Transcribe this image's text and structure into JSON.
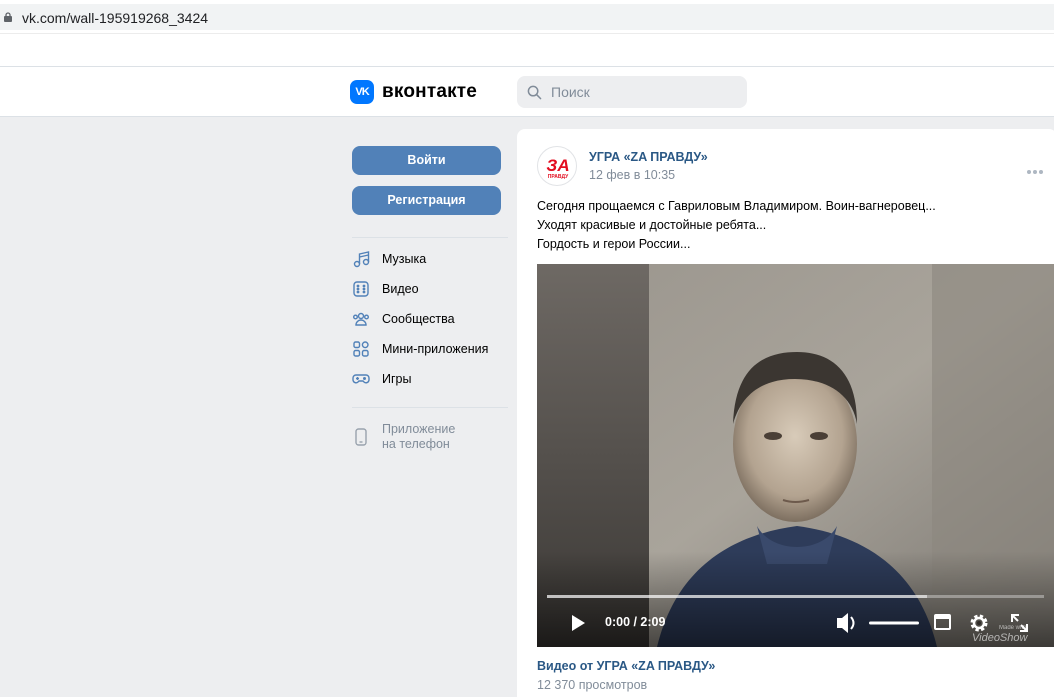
{
  "browser": {
    "url": "vk.com/wall-195919268_3424"
  },
  "header": {
    "logo_text": "вконтакте",
    "logo_mark": "VK",
    "search_placeholder": "Поиск"
  },
  "sidebar": {
    "login_label": "Войти",
    "register_label": "Регистрация",
    "items": [
      {
        "label": "Музыка",
        "icon": "music-icon"
      },
      {
        "label": "Видео",
        "icon": "video-icon"
      },
      {
        "label": "Сообщества",
        "icon": "communities-icon"
      },
      {
        "label": "Мини-приложения",
        "icon": "mini-apps-icon"
      },
      {
        "label": "Игры",
        "icon": "games-icon"
      }
    ],
    "app_line1": "Приложение",
    "app_line2": "на телефон"
  },
  "post": {
    "author": "УГРА «ZA ПРАВДУ»",
    "date": "12 фев в 10:35",
    "avatar_text_top": "ЗА",
    "avatar_text_bottom": "ПРАВДУ",
    "lines": [
      "Сегодня прощаемся с Гавриловым Владимиром. Воин-вагнеровец...",
      "Уходят красивые и достойные ребята...",
      "Гордость и герои России..."
    ],
    "video": {
      "time": "0:00 / 2:09",
      "progress": 0.0,
      "watermark_top": "Made with",
      "watermark_bottom": "VideoShow"
    },
    "video_title": "Видео от УГРА «ZA ПРАВДУ»",
    "views": "12 370 просмотров"
  },
  "colors": {
    "accent": "#5181b8",
    "link": "#2a5885",
    "muted": "#818c99",
    "vk_blue": "#0077ff"
  }
}
